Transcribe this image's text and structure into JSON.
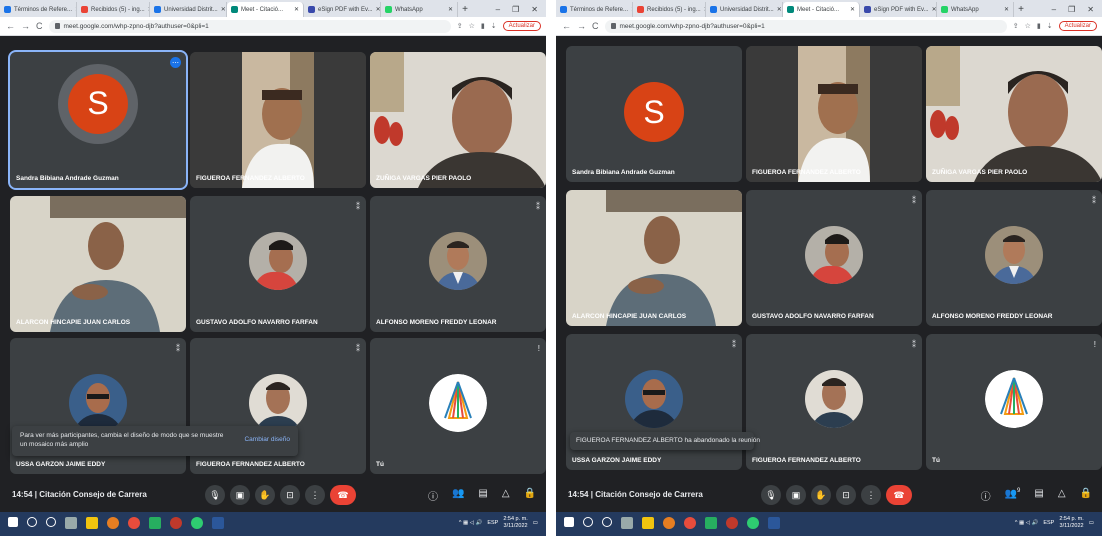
{
  "tabs": [
    {
      "label": "Términos de Refere...",
      "color": "#1a73e8"
    },
    {
      "label": "Recibidos (5) - ing...",
      "color": "#ea4335"
    },
    {
      "label": "Universidad Distrit...",
      "color": "#1a73e8"
    },
    {
      "label": "Meet - Citació...",
      "color": "#00897b"
    },
    {
      "label": "eSign PDF with Ev...",
      "color": "#3949ab"
    },
    {
      "label": "WhatsApp",
      "color": "#25d366"
    }
  ],
  "address": {
    "url": "meet.google.com/whp-zpno-djb?authuser=0&pli=1",
    "update_label": "Actualizar"
  },
  "participants": {
    "sandra": "Sandra Bibiana Andrade Guzman",
    "figueroa_tile": "FIGUEROA FERNANDEZ ALBERTO",
    "zuniga": "ZUÑIGA VARGAS PIER PAOLO",
    "alarcon": "ALARCON HINCAPIE JUAN CARLOS",
    "gustavo": "GUSTAVO ADOLFO NAVARRO FARFAN",
    "alfonso": "ALFONSO MORENO FREDDY LEONAR",
    "ussa": "USSA GARZON JAIME EDDY",
    "figueroa_bottom": "FIGUEROA FERNANDEZ ALBERTO",
    "tu": "Tú",
    "sandra_initial": "S"
  },
  "meeting": {
    "time": "14:54",
    "title": "Citación Consejo de Carrera",
    "separator": "|"
  },
  "toast_left": {
    "text": "Para ver más participantes, cambia el diseño de modo que se muestre un mosaico más amplio",
    "action": "Cambiar diseño"
  },
  "toast_right": {
    "text": "FIGUEROA FERNANDEZ ALBERTO ha abandonado la reunión"
  },
  "tray": {
    "time": "2:54 p. m.",
    "date": "3/11/2022",
    "lang": "ESP"
  },
  "participant_count_badge": "9",
  "colors": {
    "meet_bg": "#202124",
    "tile_bg": "#3c4043",
    "accent": "#1a73e8",
    "red": "#ea4335",
    "avatar_s": "#d84315"
  }
}
